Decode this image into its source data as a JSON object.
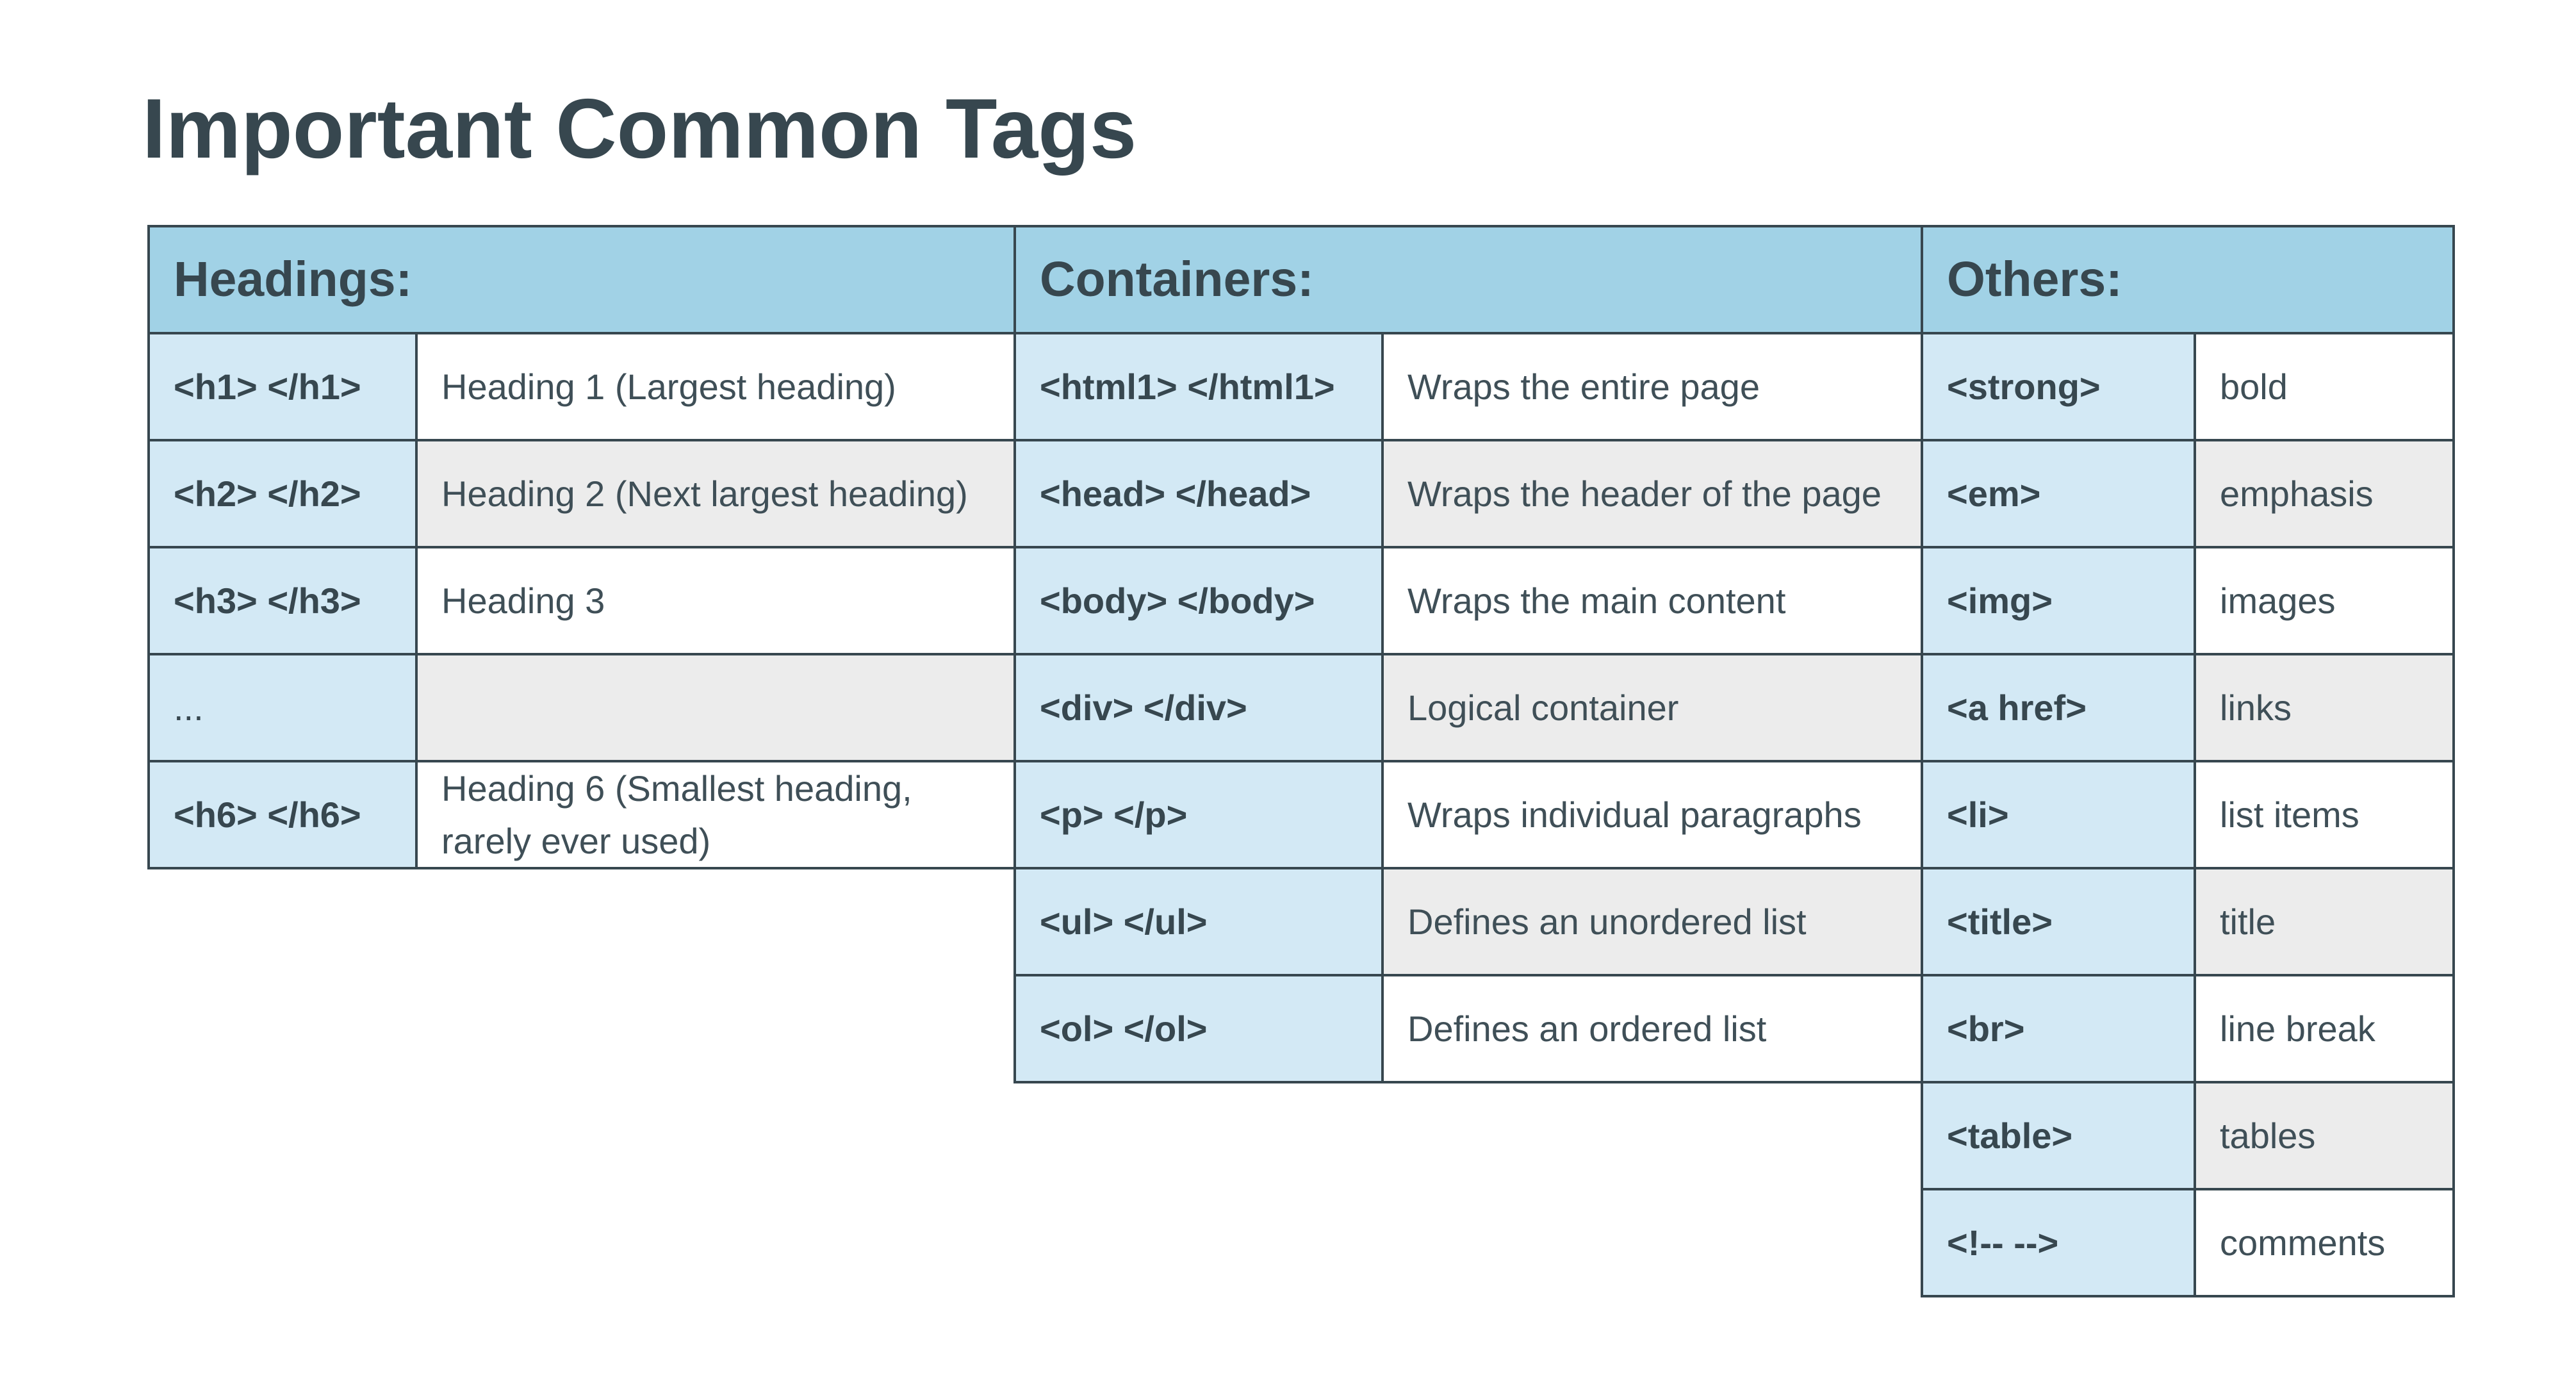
{
  "title": "Important Common Tags",
  "headings": {
    "header": "Headings:",
    "rows": [
      {
        "tag": "<h1> </h1>",
        "desc": "Heading 1 (Largest heading)"
      },
      {
        "tag": "<h2> </h2>",
        "desc": "Heading 2 (Next largest heading)"
      },
      {
        "tag": "<h3> </h3>",
        "desc": "Heading 3"
      },
      {
        "tag": "...",
        "desc": ""
      },
      {
        "tag": "<h6> </h6>",
        "desc": "Heading 6 (Smallest heading, rarely ever used)"
      }
    ]
  },
  "containers": {
    "header": "Containers:",
    "rows": [
      {
        "tag": "<html1> </html1>",
        "desc": "Wraps the entire page"
      },
      {
        "tag": "<head> </head>",
        "desc": "Wraps the header of the page"
      },
      {
        "tag": "<body> </body>",
        "desc": "Wraps the main content"
      },
      {
        "tag": "<div> </div>",
        "desc": "Logical container"
      },
      {
        "tag": "<p> </p>",
        "desc": "Wraps individual paragraphs"
      },
      {
        "tag": "<ul> </ul>",
        "desc": "Defines an unordered list"
      },
      {
        "tag": "<ol> </ol>",
        "desc": "Defines an ordered list"
      }
    ]
  },
  "others": {
    "header": "Others:",
    "rows": [
      {
        "tag": "<strong>",
        "desc": "bold"
      },
      {
        "tag": "<em>",
        "desc": "emphasis"
      },
      {
        "tag": "<img>",
        "desc": "images"
      },
      {
        "tag": "<a href>",
        "desc": "links"
      },
      {
        "tag": "<li>",
        "desc": "list items"
      },
      {
        "tag": "<title>",
        "desc": "title"
      },
      {
        "tag": "<br>",
        "desc": "line break"
      },
      {
        "tag": "<table>",
        "desc": "tables"
      },
      {
        "tag": "<!-- -->",
        "desc": "comments"
      }
    ]
  }
}
